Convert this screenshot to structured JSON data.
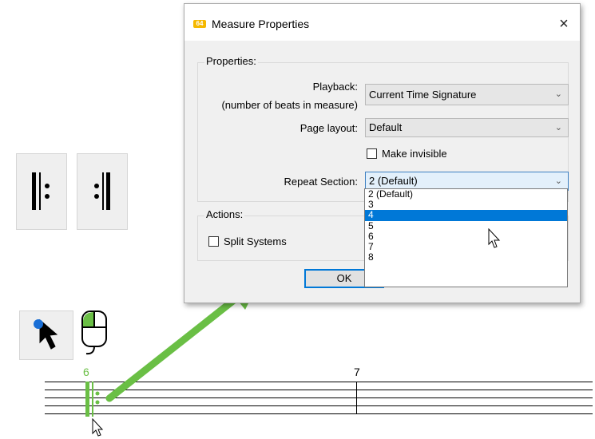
{
  "dialog": {
    "title": "Measure Properties",
    "app_icon_text": "64",
    "close_glyph": "×",
    "properties_group": "Properties:",
    "playback_label_line1": "Playback:",
    "playback_label_line2": "(number of beats in measure)",
    "playback_value": "Current Time Signature",
    "page_layout_label": "Page layout:",
    "page_layout_value": "Default",
    "make_invisible_label": "Make invisible",
    "repeat_section_label": "Repeat Section:",
    "repeat_section_value": "2 (Default)",
    "repeat_options": [
      "2 (Default)",
      "3",
      "4",
      "5",
      "6",
      "7",
      "8"
    ],
    "repeat_highlighted": "4",
    "actions_group": "Actions:",
    "split_systems_label": "Split Systems",
    "ok_label": "OK"
  },
  "score": {
    "measure_numbers": [
      "6",
      "7"
    ]
  },
  "colors": {
    "accent_green": "#6abf45",
    "highlight_blue": "#0078d7"
  },
  "icons": [
    "repeat-start-icon",
    "repeat-end-icon",
    "cursor-select-icon",
    "mouse-left-click-icon",
    "chevron-down-icon",
    "arrow-pointer-icon"
  ]
}
